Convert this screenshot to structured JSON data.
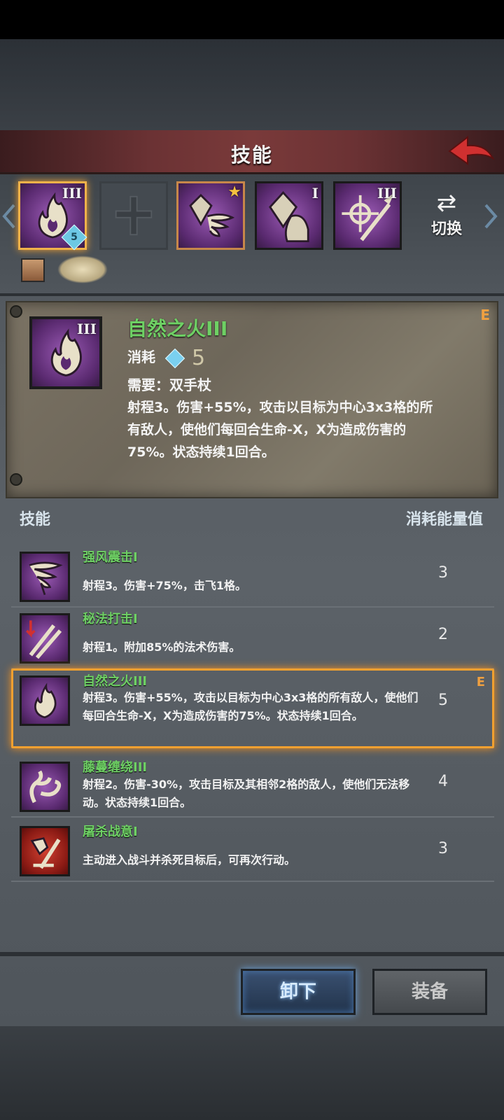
{
  "header": {
    "title": "技能"
  },
  "equipped": {
    "slots": [
      {
        "roman": "III",
        "cost": "5"
      },
      {
        "roman": ""
      },
      {
        "roman": ""
      },
      {
        "roman": "I"
      },
      {
        "roman": "III"
      }
    ],
    "switch_label": "切换"
  },
  "detail": {
    "name": "自然之火III",
    "rank": "E",
    "roman": "III",
    "cost_label": "消耗",
    "cost_value": "5",
    "requirement": "需要：双手杖",
    "description": "射程3。伤害+55%，攻击以目标为中心3x3格的所有敌人，使他们每回合生命-X，X为造成伤害的75%。状态持续1回合。"
  },
  "list": {
    "header_left": "技能",
    "header_right": "消耗能量值",
    "items": [
      {
        "name": "强风震击I",
        "desc": "射程3。伤害+75%，击飞1格。",
        "cost": "3",
        "rank": ""
      },
      {
        "name": "秘法打击I",
        "desc": "射程1。附加85%的法术伤害。",
        "cost": "2",
        "rank": ""
      },
      {
        "name": "自然之火III",
        "desc": "射程3。伤害+55%，攻击以目标为中心3x3格的所有敌人，使他们每回合生命-X，X为造成伤害的75%。状态持续1回合。",
        "cost": "5",
        "rank": "E"
      },
      {
        "name": "藤蔓缠绕III",
        "desc": "射程2。伤害-30%，攻击目标及其相邻2格的敌人，使他们无法移动。状态持续1回合。",
        "cost": "4",
        "rank": ""
      },
      {
        "name": "屠杀战意I",
        "desc": "主动进入战斗并杀死目标后，可再次行动。",
        "cost": "3",
        "rank": ""
      }
    ]
  },
  "buttons": {
    "unequip": "卸下",
    "equip": "装备"
  },
  "colors": {
    "accent_green": "#6ed064",
    "selection_orange": "#f0a030",
    "rank_orange": "#f0a040"
  }
}
